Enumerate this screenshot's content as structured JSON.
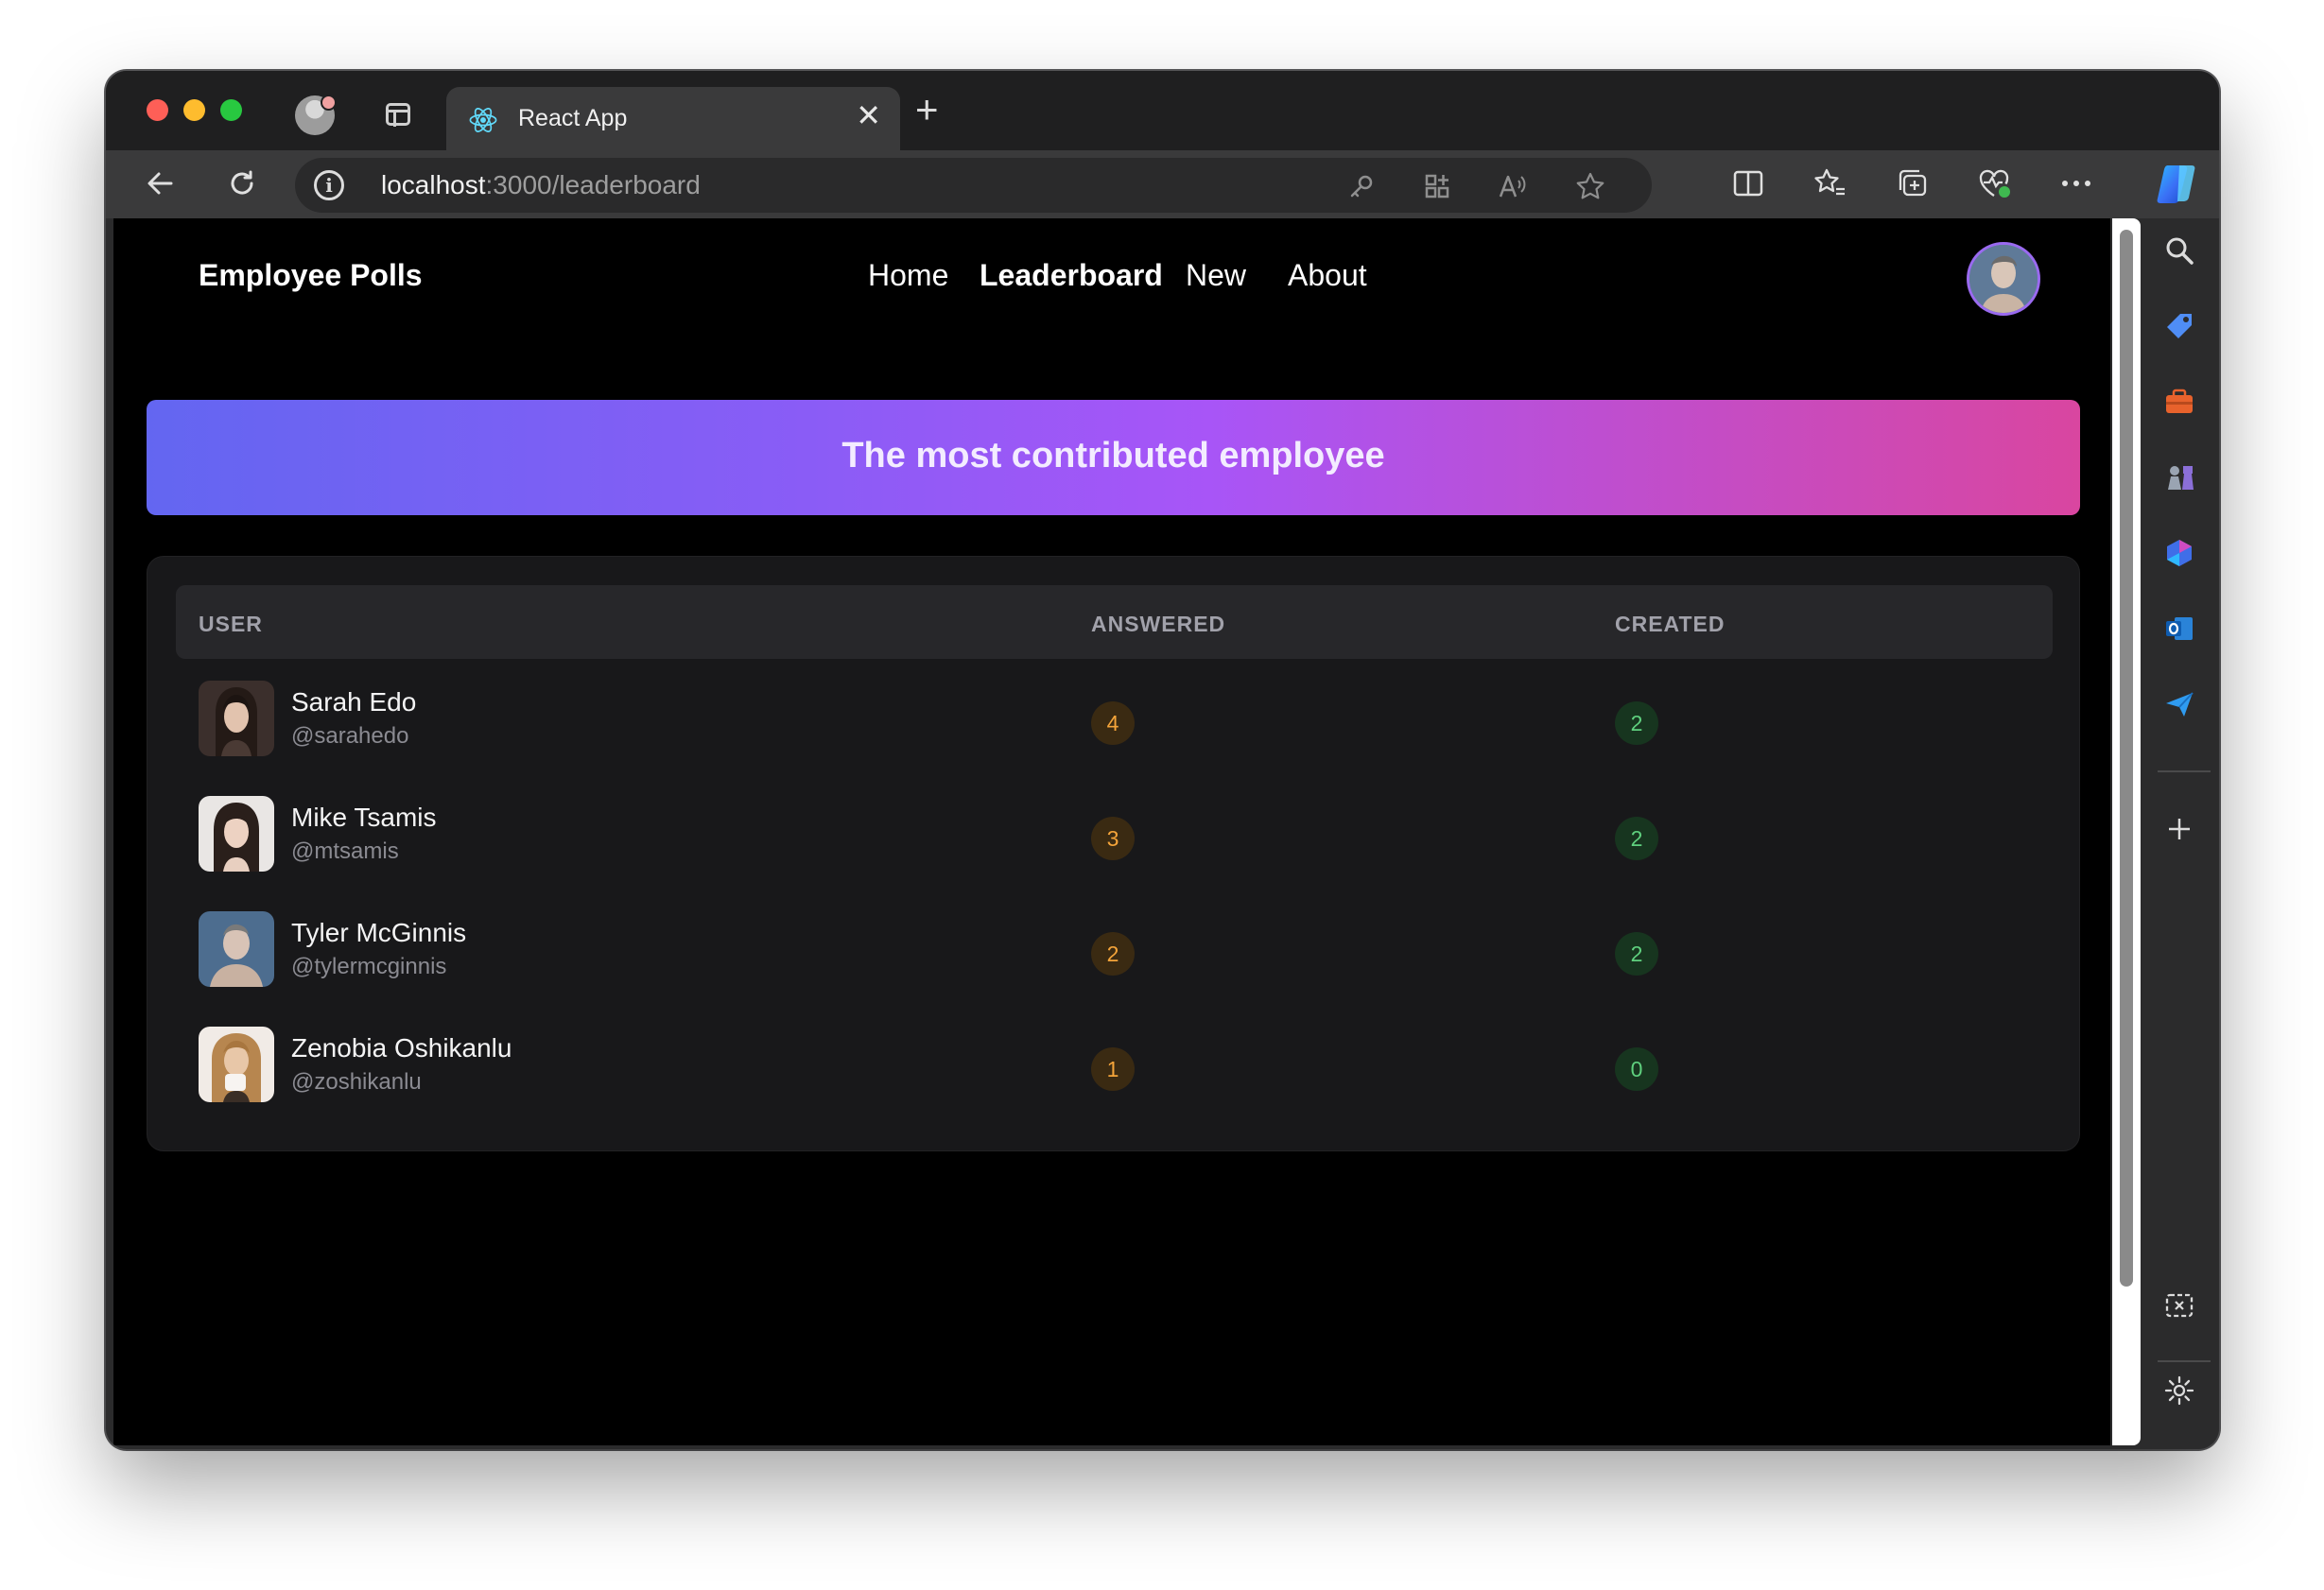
{
  "browser": {
    "tab_title": "React App",
    "tab_close": "✕",
    "new_tab": "+",
    "url_host": "localhost",
    "url_path": ":3000/leaderboard",
    "info_icon_glyph": "i"
  },
  "app": {
    "brand": "Employee Polls",
    "nav": {
      "home": "Home",
      "leaderboard": "Leaderboard",
      "new": "New",
      "about": "About"
    },
    "banner": "The most contributed employee",
    "table": {
      "headers": {
        "user": "USER",
        "answered": "ANSWERED",
        "created": "CREATED"
      },
      "rows": [
        {
          "name": "Sarah Edo",
          "handle": "@sarahedo",
          "answered": "4",
          "created": "2"
        },
        {
          "name": "Mike Tsamis",
          "handle": "@mtsamis",
          "answered": "3",
          "created": "2"
        },
        {
          "name": "Tyler McGinnis",
          "handle": "@tylermcginnis",
          "answered": "2",
          "created": "2"
        },
        {
          "name": "Zenobia Oshikanlu",
          "handle": "@zoshikanlu",
          "answered": "1",
          "created": "0"
        }
      ]
    }
  },
  "colors": {
    "accent_underline": "#3b6bf0",
    "banner_gradient_start": "#6366f1",
    "banner_gradient_end": "#d946a0",
    "answered_badge": "#f4a43a",
    "created_badge": "#5fd07e"
  }
}
